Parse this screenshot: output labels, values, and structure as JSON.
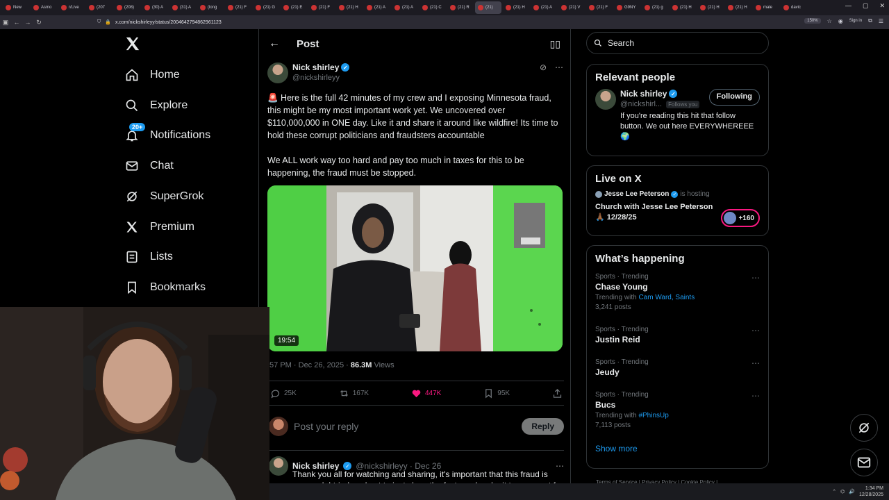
{
  "browser": {
    "tabs": [
      {
        "label": "New"
      },
      {
        "label": "Asmo"
      },
      {
        "label": "r/Live"
      },
      {
        "label": "(207"
      },
      {
        "label": "(208)"
      },
      {
        "label": "(30) A"
      },
      {
        "label": "(31) A"
      },
      {
        "label": "(long"
      },
      {
        "label": "(21) F"
      },
      {
        "label": "(21) G"
      },
      {
        "label": "(21) E"
      },
      {
        "label": "(21) F"
      },
      {
        "label": "(21) H"
      },
      {
        "label": "(21) A"
      },
      {
        "label": "(21) A"
      },
      {
        "label": "(21) C"
      },
      {
        "label": "(21) R"
      },
      {
        "label": "(21)"
      },
      {
        "label": "(21) H"
      },
      {
        "label": "(21) A"
      },
      {
        "label": "(21) V"
      },
      {
        "label": "(21) F"
      },
      {
        "label": "G9NY"
      },
      {
        "label": "(21) g"
      },
      {
        "label": "(21) H"
      },
      {
        "label": "(21) H"
      },
      {
        "label": "(21) H"
      },
      {
        "label": "male"
      },
      {
        "label": "davic"
      }
    ],
    "url": "x.com/nickshirleyy/status/2004642794862961123",
    "zoom": "150%",
    "sign_in": "Sign in"
  },
  "sidebar": {
    "items": [
      {
        "label": "Home"
      },
      {
        "label": "Explore"
      },
      {
        "label": "Notifications",
        "badge": "20+"
      },
      {
        "label": "Chat"
      },
      {
        "label": "SuperGrok"
      },
      {
        "label": "Premium"
      },
      {
        "label": "Lists"
      },
      {
        "label": "Bookmarks"
      }
    ]
  },
  "post": {
    "header_title": "Post",
    "author_name": "Nick shirley",
    "author_handle": "@nickshirleyy",
    "text_p1": "🚨 Here is the full 42 minutes of my crew and I exposing Minnesota fraud, this might be my most important work yet. We uncovered over $110,000,000 in ONE day. Like it and share it around like wildfire! Its time to hold these corrupt politicians and fraudsters accountable",
    "text_p2": "We ALL work way too hard and pay too much in taxes for this to be happening, the fraud must be stopped.",
    "video_duration": "19:54",
    "timestamp": ":57 PM · Dec 26, 2025 · ",
    "views_count": "86.3M",
    "views_label": " Views",
    "stats": {
      "replies": "25K",
      "reposts": "167K",
      "likes": "447K",
      "bookmarks": "95K"
    },
    "reply_placeholder": "Post your reply",
    "reply_button": "Reply"
  },
  "reply_tweet": {
    "author_name": "Nick shirley",
    "author_handle": "@nickshirleyy · Dec 26",
    "text": "Thank you all for watching and sharing, it's important that this fraud is exposed. I tried my best to just show the facts and make it transparent for"
  },
  "right": {
    "search_placeholder": "Search",
    "relevant_title": "Relevant people",
    "person_name": "Nick shirley",
    "person_handle": "@nickshirl...",
    "follows_you": "Follows you",
    "following_label": "Following",
    "person_bio": "If you're reading this hit that follow button. We out here EVERYWHEREEE 🌍",
    "live_title": "Live on X",
    "live_host": "Jesse Lee Peterson",
    "live_hosting": "is hosting",
    "live_space_title": "Church with Jesse Lee Peterson 🙏🏾 12/28/25",
    "live_listeners": "+160",
    "happening_title": "What’s happening",
    "trends": [
      {
        "category": "Sports · Trending",
        "name": "Chase Young",
        "sub_prefix": "Trending with ",
        "sub_links": "Cam Ward, Saints",
        "posts": "3,241 posts"
      },
      {
        "category": "Sports · Trending",
        "name": "Justin Reid",
        "sub_prefix": "",
        "sub_links": "",
        "posts": ""
      },
      {
        "category": "Sports · Trending",
        "name": "Jeudy",
        "sub_prefix": "",
        "sub_links": "",
        "posts": ""
      },
      {
        "category": "Sports · Trending",
        "name": "Bucs",
        "sub_prefix": "Trending with ",
        "sub_links": "#PhinsUp",
        "posts": "7,113 posts"
      }
    ],
    "show_more": "Show more",
    "footer": "Terms of Service  |  Privacy Policy  |  Cookie Policy  |"
  },
  "taskbar": {
    "time": "1:34 PM",
    "date": "12/28/2025"
  },
  "colors": {
    "accent": "#1d9bf0",
    "like": "#f91880",
    "border": "#2f3336",
    "muted": "#71767b"
  }
}
